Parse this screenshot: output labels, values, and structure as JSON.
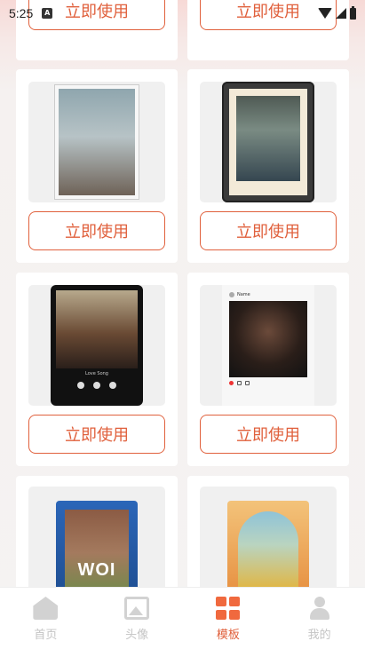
{
  "status_bar": {
    "time": "5:25",
    "notification_icon": "A"
  },
  "templates": [
    {
      "name": "white-wood-frame",
      "button_label": "立即使用"
    },
    {
      "name": "black-mat-frame",
      "button_label": "立即使用"
    },
    {
      "name": "music-player-phone",
      "button_label": "立即使用",
      "song_title": "Love Song"
    },
    {
      "name": "instagram-post",
      "button_label": "立即使用",
      "account": "Name"
    },
    {
      "name": "floral-wall-blue",
      "button_label": "立即使用",
      "wall_text": "WOI"
    },
    {
      "name": "floral-sunflower",
      "button_label": "立即使用"
    }
  ],
  "top_partial_buttons": [
    "立即使用",
    "立即使用"
  ],
  "tab_bar": {
    "items": [
      {
        "label": "首页",
        "icon": "home-icon",
        "active": false
      },
      {
        "label": "头像",
        "icon": "image-icon",
        "active": false
      },
      {
        "label": "模板",
        "icon": "grid-icon",
        "active": true
      },
      {
        "label": "我的",
        "icon": "person-icon",
        "active": false
      }
    ]
  },
  "colors": {
    "accent": "#e0603c",
    "inactive": "#c4c4c4"
  }
}
